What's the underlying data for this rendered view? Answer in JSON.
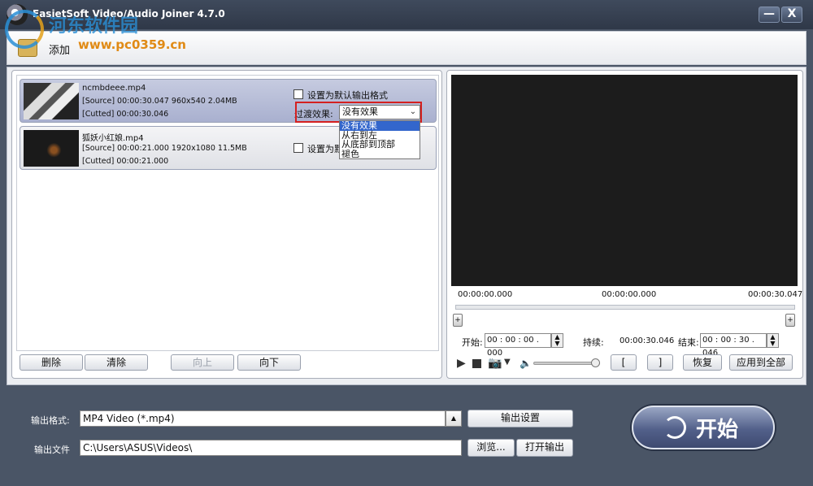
{
  "window": {
    "title": "EasietSoft Video/Audio Joiner 4.7.0",
    "minimize_glyph": "—",
    "close_glyph": "X"
  },
  "watermark": {
    "site_name": "河东软件园",
    "url": "www.pc0359.cn"
  },
  "toolbar": {
    "add_label": "添加",
    "add_icon": "add-files-icon"
  },
  "files": [
    {
      "name": "ncmbdeee.mp4",
      "source": "[Source]  00:00:30.047  960x540  2.04MB",
      "cutted": "[Cutted]  00:00:30.046",
      "default_format_label": "设置为默认输出格式",
      "transition_label": "过渡效果:",
      "transition_value": "没有效果"
    },
    {
      "name": "狐妖小红娘.mp4",
      "source": "[Source]  00:00:21.000  1920x1080  11.5MB",
      "cutted": "[Cutted]  00:00:21.000",
      "default_format_label": "设置为默认输出格式"
    }
  ],
  "transition_options": [
    "没有效果",
    "从右到左",
    "从底部到顶部",
    "褪色"
  ],
  "list_buttons": {
    "delete": "删除",
    "clear": "清除",
    "up": "向上",
    "down": "向下"
  },
  "preview": {
    "time_start": "00:00:00.000",
    "time_mid": "00:00:00.000",
    "time_end": "00:00:30.047",
    "start_label": "开始:",
    "start_value": "00 : 00 : 00 . 000",
    "duration_label": "持续:",
    "duration_value": "00:00:30.046",
    "end_label": "结束:",
    "end_value": "00 : 00 : 30 . 046",
    "mark_in": "[",
    "mark_out": "]",
    "restore": "恢复",
    "apply_all": "应用到全部"
  },
  "output": {
    "format_label": "输出格式:",
    "format_value": "MP4 Video (*.mp4)",
    "settings_button": "输出设置",
    "file_label": "输出文件",
    "file_value": "C:\\Users\\ASUS\\Videos\\",
    "browse_button": "浏览...",
    "open_button": "打开输出"
  },
  "start_button": {
    "label": "开始"
  },
  "colors": {
    "title_bar": "#3f4a5c",
    "selected_item": "#a9b0cf",
    "highlight_border": "#d42020",
    "dropdown_selected": "#3366cc",
    "start_button": "#52608a"
  }
}
